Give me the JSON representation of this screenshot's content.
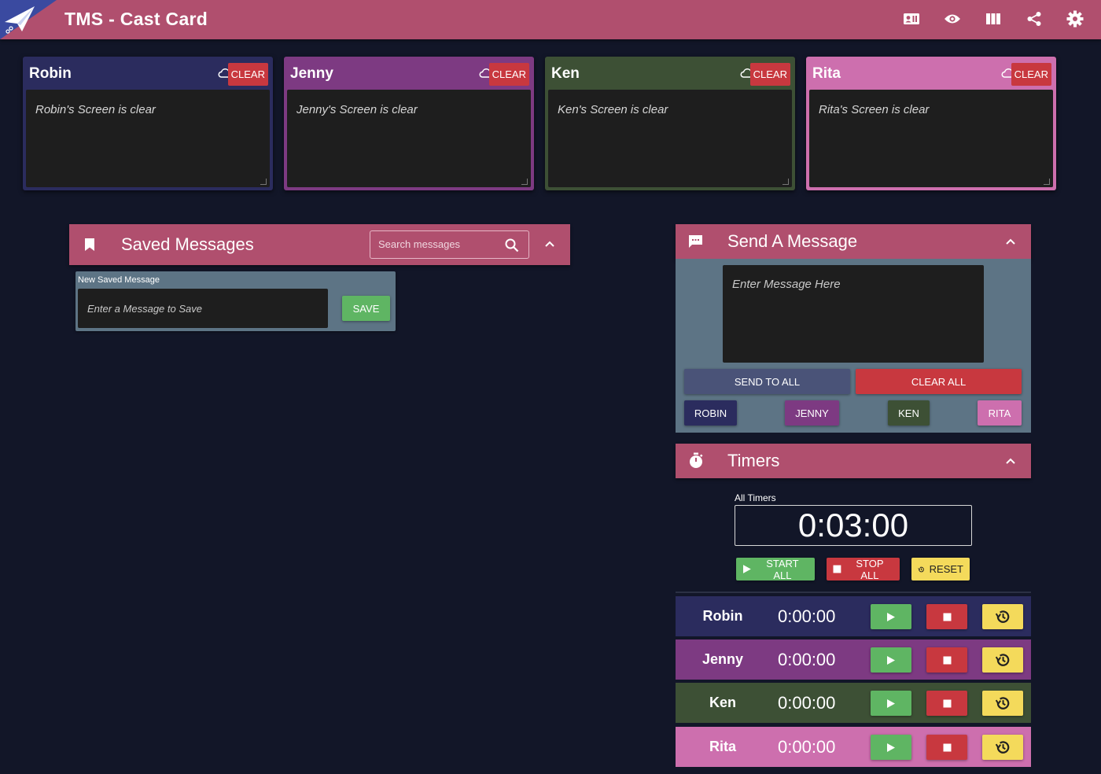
{
  "header": {
    "title": "TMS - Cast Card",
    "icons": [
      "contact-card-icon",
      "eye-icon",
      "columns-icon",
      "share-icon",
      "gear-icon"
    ]
  },
  "colors": {
    "header": "#b04f6e",
    "robin": "#2b2c5e",
    "jenny": "#7d3a82",
    "ken": "#3d5035",
    "rita": "#cd6fae",
    "clear_red": "#c8383f",
    "save_green": "#5fb563",
    "reset_yellow": "#f4da5b",
    "panel_body": "#5d7485"
  },
  "cards": [
    {
      "name": "Robin",
      "clear_label": "CLEAR",
      "text": "Robin's Screen is clear"
    },
    {
      "name": "Jenny",
      "clear_label": "CLEAR",
      "text": "Jenny's Screen is clear"
    },
    {
      "name": "Ken",
      "clear_label": "CLEAR",
      "text": "Ken's Screen is clear"
    },
    {
      "name": "Rita",
      "clear_label": "CLEAR",
      "text": "Rita's Screen is clear"
    }
  ],
  "saved": {
    "title": "Saved Messages",
    "search_placeholder": "Search messages",
    "new_label": "New Saved Message",
    "new_placeholder": "Enter a Message to Save",
    "save_label": "SAVE"
  },
  "send": {
    "title": "Send A Message",
    "placeholder": "Enter Message Here",
    "send_all_label": "SEND TO ALL",
    "clear_all_label": "CLEAR ALL",
    "cast": [
      "ROBIN",
      "JENNY",
      "KEN",
      "RITA"
    ]
  },
  "timers": {
    "title": "Timers",
    "all_label": "All Timers",
    "all_value": "0:03:00",
    "start_all": "START ALL",
    "stop_all": "STOP ALL",
    "reset": "RESET",
    "rows": [
      {
        "name": "Robin",
        "time": "0:00:00"
      },
      {
        "name": "Jenny",
        "time": "0:00:00"
      },
      {
        "name": "Ken",
        "time": "0:00:00"
      },
      {
        "name": "Rita",
        "time": "0:00:00"
      }
    ]
  }
}
